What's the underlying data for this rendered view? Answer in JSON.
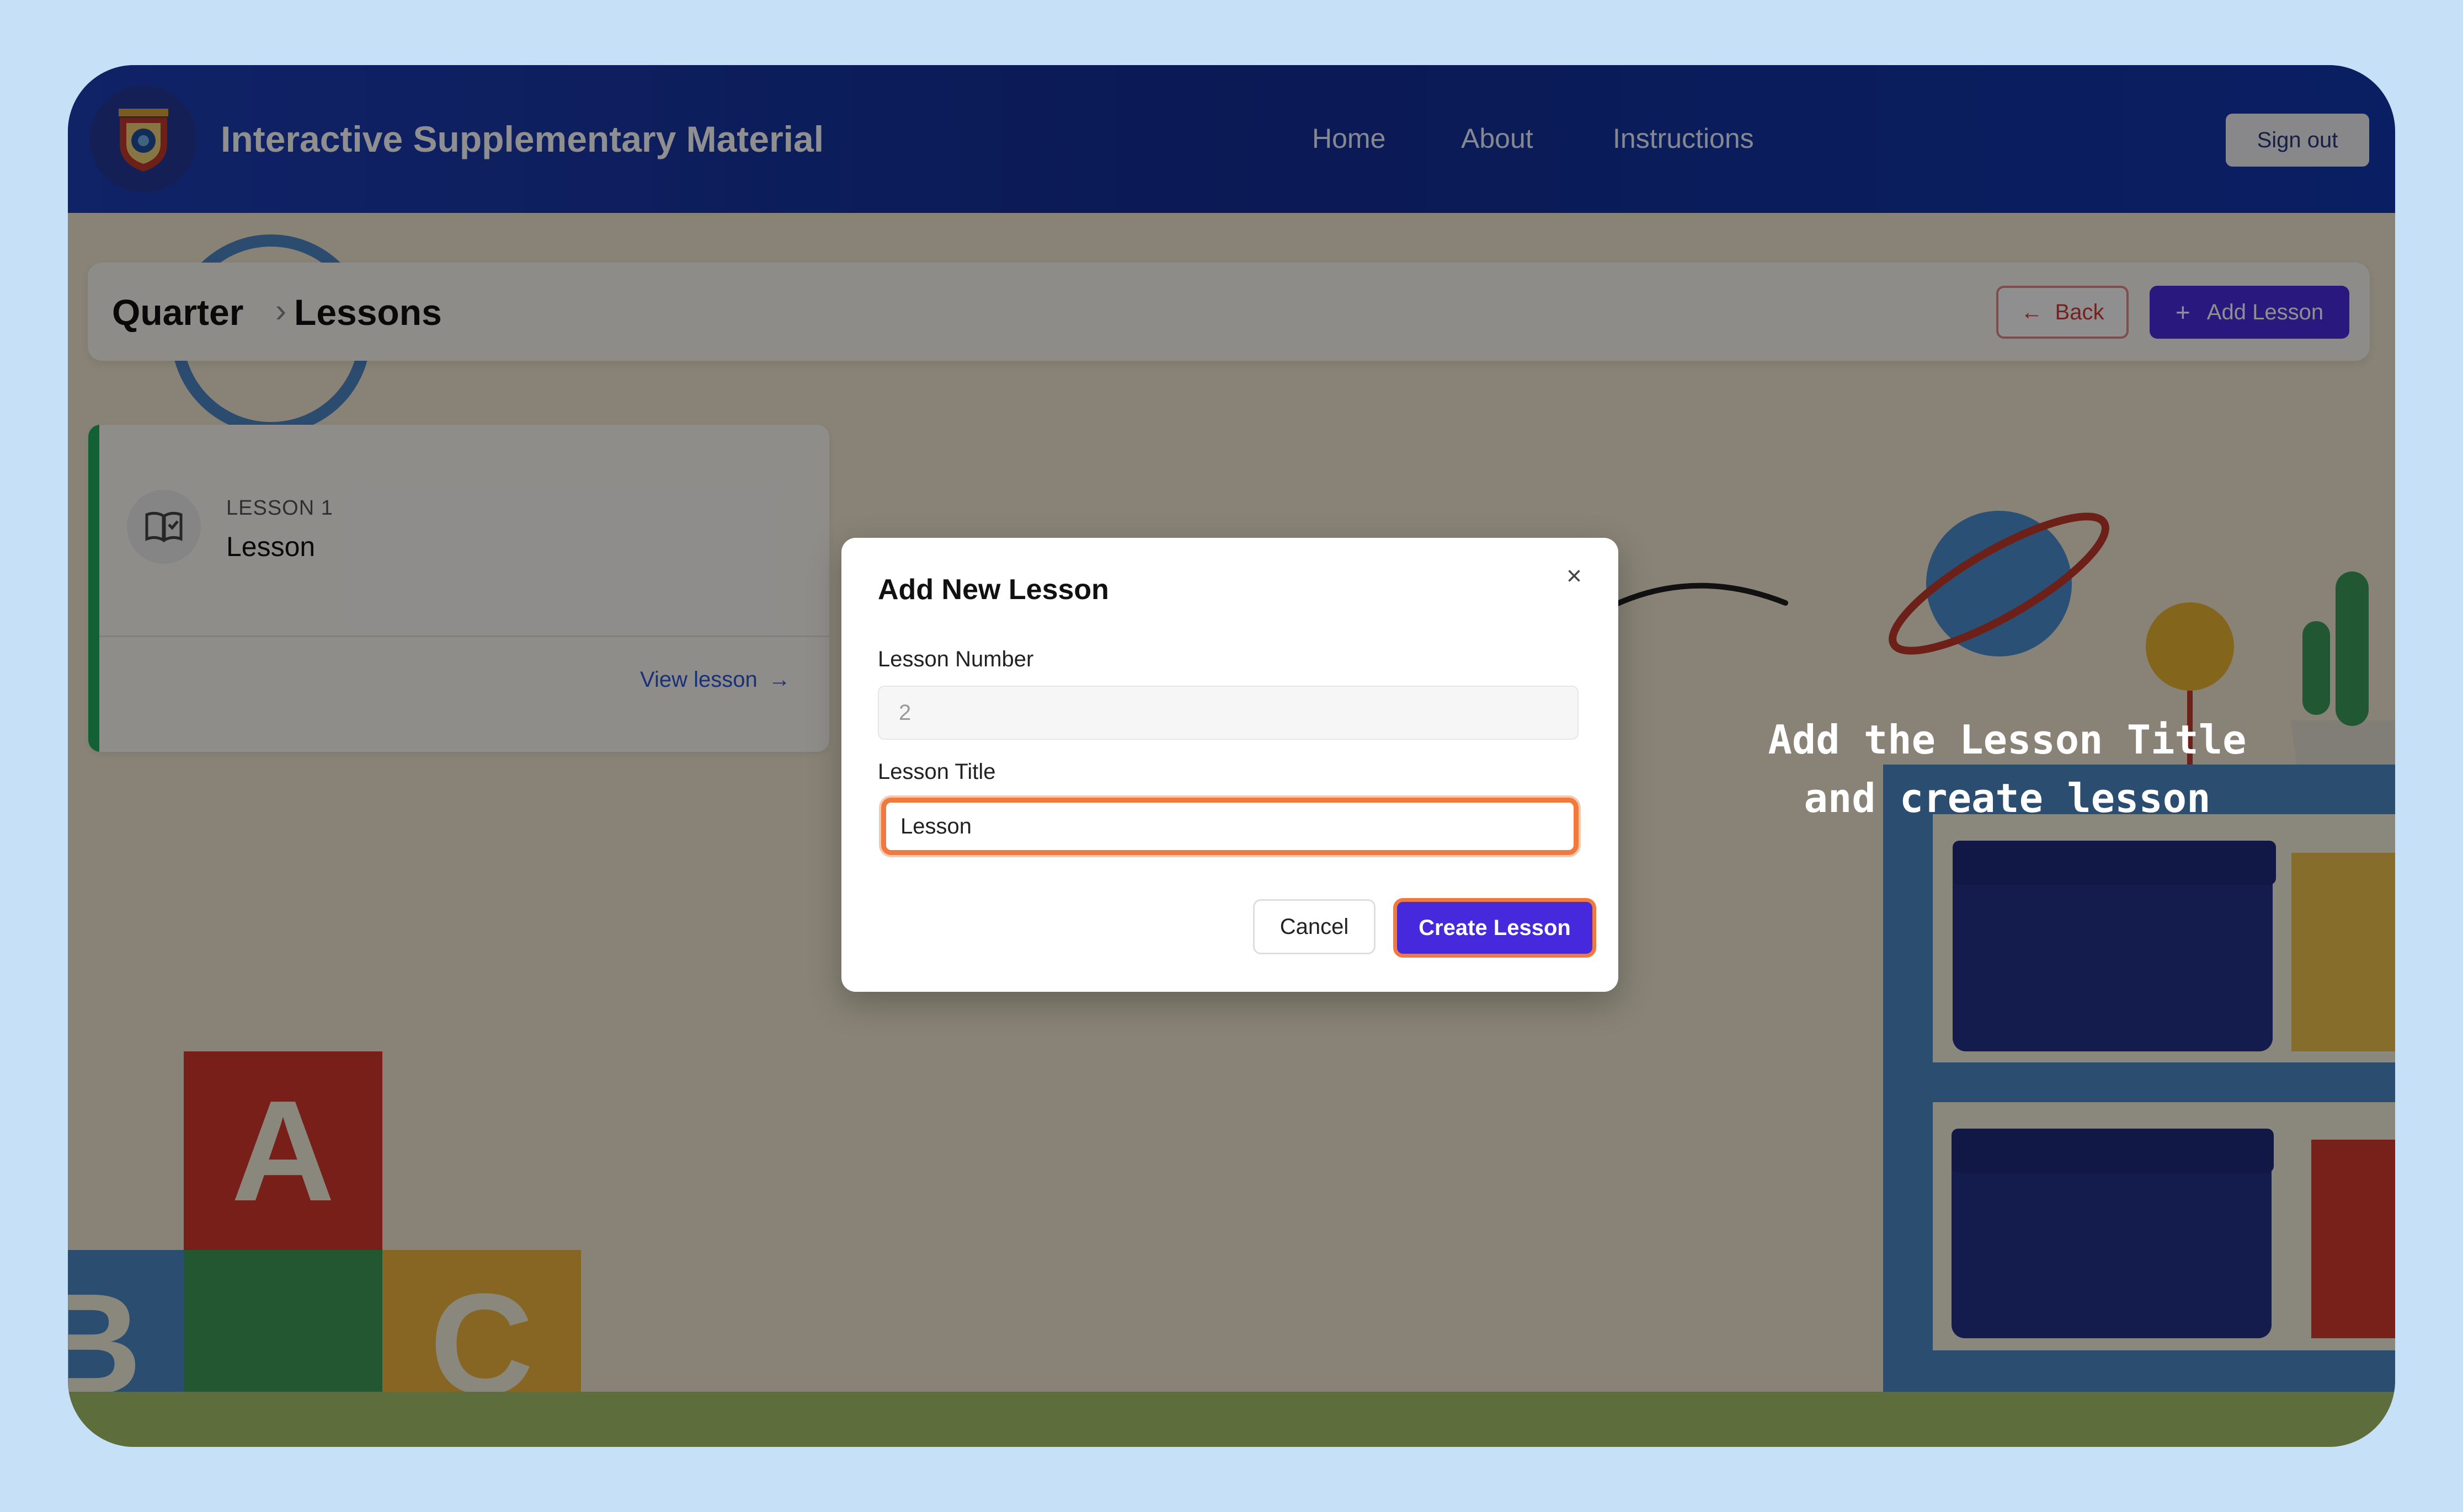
{
  "header": {
    "app_title": "Interactive Supplementary Material",
    "nav": [
      "Home",
      "About",
      "Instructions"
    ],
    "sign_out": "Sign out"
  },
  "breadcrumb": {
    "items": [
      "Quarter",
      "Lessons"
    ],
    "separator": "›"
  },
  "actions": {
    "back": "Back",
    "add_lesson": "Add Lesson"
  },
  "lesson_card": {
    "label": "LESSON 1",
    "title": "Lesson",
    "view": "View lesson"
  },
  "decor": {
    "block_letters": [
      "A",
      "B",
      "C"
    ]
  },
  "modal": {
    "title": "Add New Lesson",
    "close": "×",
    "lesson_number_label": "Lesson Number",
    "lesson_number_value": "2",
    "lesson_title_label": "Lesson Title",
    "lesson_title_value": "Lesson",
    "cancel": "Cancel",
    "create": "Create Lesson"
  },
  "annotation": {
    "line1": "Add the Lesson Title",
    "line2": "and create lesson"
  },
  "colors": {
    "background": "#c5e0f7",
    "header": "#1a3aa8",
    "primary": "#4729dd",
    "highlight": "#f07a3e",
    "lesson_accent": "#1fae5e",
    "back": "#d43a3a"
  }
}
